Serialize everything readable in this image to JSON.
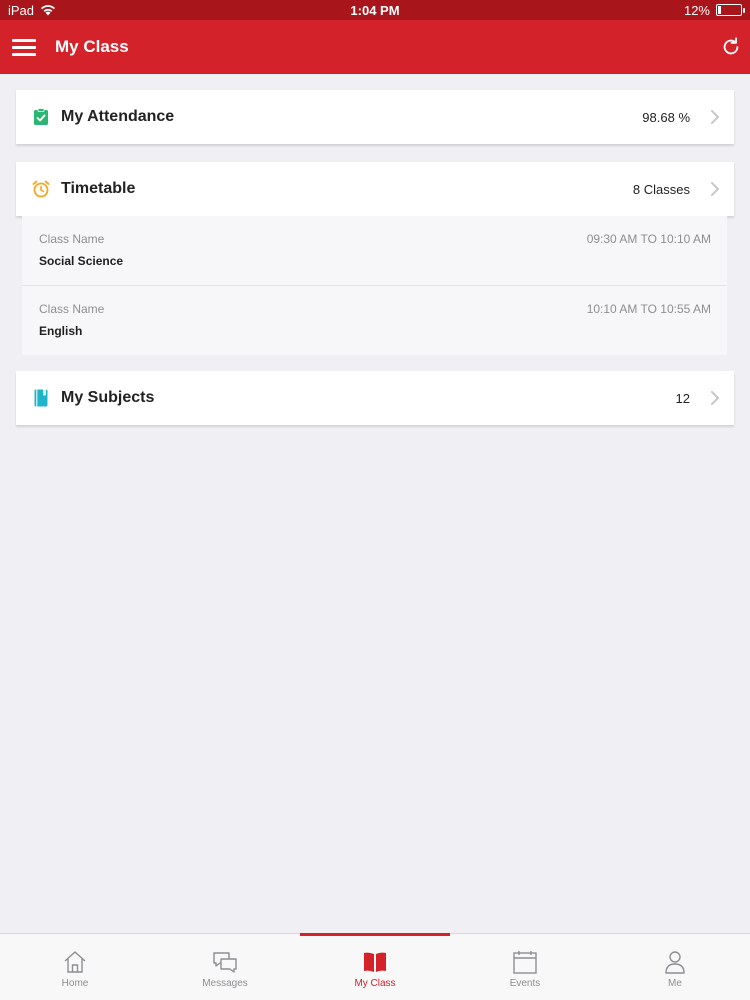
{
  "status_bar": {
    "device": "iPad",
    "time": "1:04 PM",
    "battery_text": "12%",
    "battery_level": 0.12
  },
  "nav": {
    "title": "My Class",
    "menu_icon": "hamburger-menu-icon",
    "refresh_icon": "refresh-icon"
  },
  "attendance": {
    "title": "My Attendance",
    "value": "98.68 %",
    "icon": "clipboard-check-icon",
    "icon_color": "#2bb673"
  },
  "timetable": {
    "title": "Timetable",
    "value": "8 Classes",
    "icon": "alarm-clock-icon",
    "icon_color": "#f5a623",
    "classes": [
      {
        "label": "Class Name",
        "name": "Social Science",
        "time": "09:30 AM TO 10:10 AM"
      },
      {
        "label": "Class Name",
        "name": "English",
        "time": "10:10 AM TO 10:55 AM"
      }
    ]
  },
  "subjects": {
    "title": "My Subjects",
    "value": "12",
    "icon": "book-icon",
    "icon_color": "#1fb5c9"
  },
  "tabs": [
    {
      "label": "Home",
      "icon": "home-icon",
      "active": false
    },
    {
      "label": "Messages",
      "icon": "messages-icon",
      "active": false
    },
    {
      "label": "My Class",
      "icon": "open-book-icon",
      "active": true
    },
    {
      "label": "Events",
      "icon": "calendar-icon",
      "active": false
    },
    {
      "label": "Me",
      "icon": "person-icon",
      "active": false
    }
  ],
  "colors": {
    "brand_red": "#d3222a",
    "status_bar": "#a8151b",
    "background": "#efeff4"
  }
}
